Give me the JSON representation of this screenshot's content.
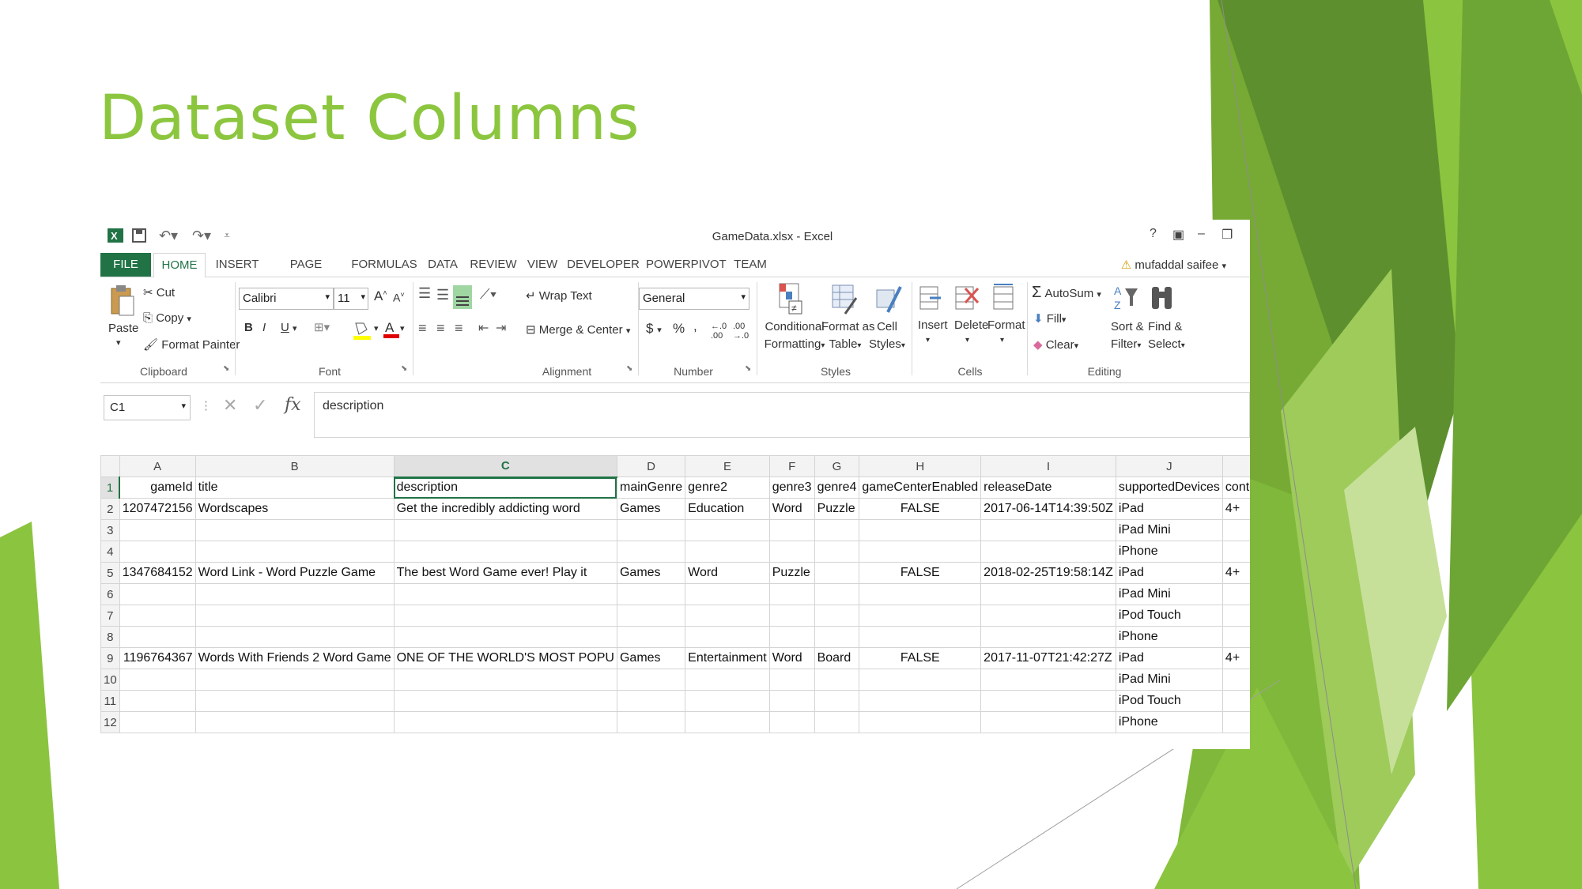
{
  "slide": {
    "title": "Dataset Columns",
    "accent_color": "#8cc63f"
  },
  "window": {
    "title": "GameData.xlsx - Excel",
    "user": "mufaddal saifee",
    "controls": [
      "?",
      "▣",
      "–",
      "❐"
    ]
  },
  "tabs": [
    "FILE",
    "HOME",
    "INSERT",
    "PAGE LAYOUT",
    "FORMULAS",
    "DATA",
    "REVIEW",
    "VIEW",
    "DEVELOPER",
    "POWERPIVOT",
    "TEAM"
  ],
  "ribbon": {
    "clipboard": {
      "paste": "Paste",
      "cut": "Cut",
      "copy": "Copy",
      "format_painter": "Format Painter",
      "label": "Clipboard"
    },
    "font": {
      "name": "Calibri",
      "size": "11",
      "bold": "B",
      "italic": "I",
      "underline": "U",
      "label": "Font"
    },
    "alignment": {
      "wrap_text": "Wrap Text",
      "merge_center": "Merge & Center",
      "label": "Alignment"
    },
    "number": {
      "format": "General",
      "currency": "$",
      "percent": "%",
      "comma": ",",
      "label": "Number"
    },
    "styles": {
      "conditional_1": "Conditional",
      "conditional_2": "Formatting",
      "format_table_1": "Format as",
      "format_table_2": "Table",
      "cell_styles_1": "Cell",
      "cell_styles_2": "Styles",
      "label": "Styles"
    },
    "cells": {
      "insert": "Insert",
      "delete": "Delete",
      "format": "Format",
      "label": "Cells"
    },
    "editing": {
      "autosum": "AutoSum",
      "fill": "Fill",
      "clear": "Clear",
      "sort_1": "Sort &",
      "sort_2": "Filter",
      "find_1": "Find &",
      "find_2": "Select",
      "label": "Editing"
    }
  },
  "formula_bar": {
    "name_box": "C1",
    "fx": "fx",
    "content": "description"
  },
  "sheet": {
    "columns": [
      "A",
      "B",
      "C",
      "D",
      "E",
      "F",
      "G",
      "H",
      "I",
      "J",
      ""
    ],
    "rows": [
      {
        "n": "1",
        "cells": [
          "gameId",
          "title",
          "description",
          "mainGenre",
          "genre2",
          "genre3",
          "genre4",
          "gameCenterEnabled",
          "releaseDate",
          "supportedDevices",
          "conter"
        ]
      },
      {
        "n": "2",
        "cells": [
          "1207472156",
          "Wordscapes",
          "Get the incredibly addicting word",
          "Games",
          "Education",
          "Word",
          "Puzzle",
          "FALSE",
          "2017-06-14T14:39:50Z",
          "iPad",
          "4+"
        ]
      },
      {
        "n": "3",
        "cells": [
          "",
          "",
          "",
          "",
          "",
          "",
          "",
          "",
          "",
          "iPad Mini",
          ""
        ]
      },
      {
        "n": "4",
        "cells": [
          "",
          "",
          "",
          "",
          "",
          "",
          "",
          "",
          "",
          "iPhone",
          ""
        ]
      },
      {
        "n": "5",
        "cells": [
          "1347684152",
          "Word Link - Word Puzzle Game",
          "The best Word Game ever! Play it",
          "Games",
          "Word",
          "Puzzle",
          "",
          "FALSE",
          "2018-02-25T19:58:14Z",
          "iPad",
          "4+"
        ]
      },
      {
        "n": "6",
        "cells": [
          "",
          "",
          "",
          "",
          "",
          "",
          "",
          "",
          "",
          "iPad Mini",
          ""
        ]
      },
      {
        "n": "7",
        "cells": [
          "",
          "",
          "",
          "",
          "",
          "",
          "",
          "",
          "",
          "iPod Touch",
          ""
        ]
      },
      {
        "n": "8",
        "cells": [
          "",
          "",
          "",
          "",
          "",
          "",
          "",
          "",
          "",
          "iPhone",
          ""
        ]
      },
      {
        "n": "9",
        "cells": [
          "1196764367",
          "Words With Friends 2 Word Game",
          "ONE OF THE WORLD'S MOST POPU",
          "Games",
          "Entertainment",
          "Word",
          "Board",
          "FALSE",
          "2017-11-07T21:42:27Z",
          "iPad",
          "4+"
        ]
      },
      {
        "n": "10",
        "cells": [
          "",
          "",
          "",
          "",
          "",
          "",
          "",
          "",
          "",
          "iPad Mini",
          ""
        ]
      },
      {
        "n": "11",
        "cells": [
          "",
          "",
          "",
          "",
          "",
          "",
          "",
          "",
          "",
          "iPod Touch",
          ""
        ]
      },
      {
        "n": "12",
        "cells": [
          "",
          "",
          "",
          "",
          "",
          "",
          "",
          "",
          "",
          "iPhone",
          ""
        ]
      }
    ]
  }
}
